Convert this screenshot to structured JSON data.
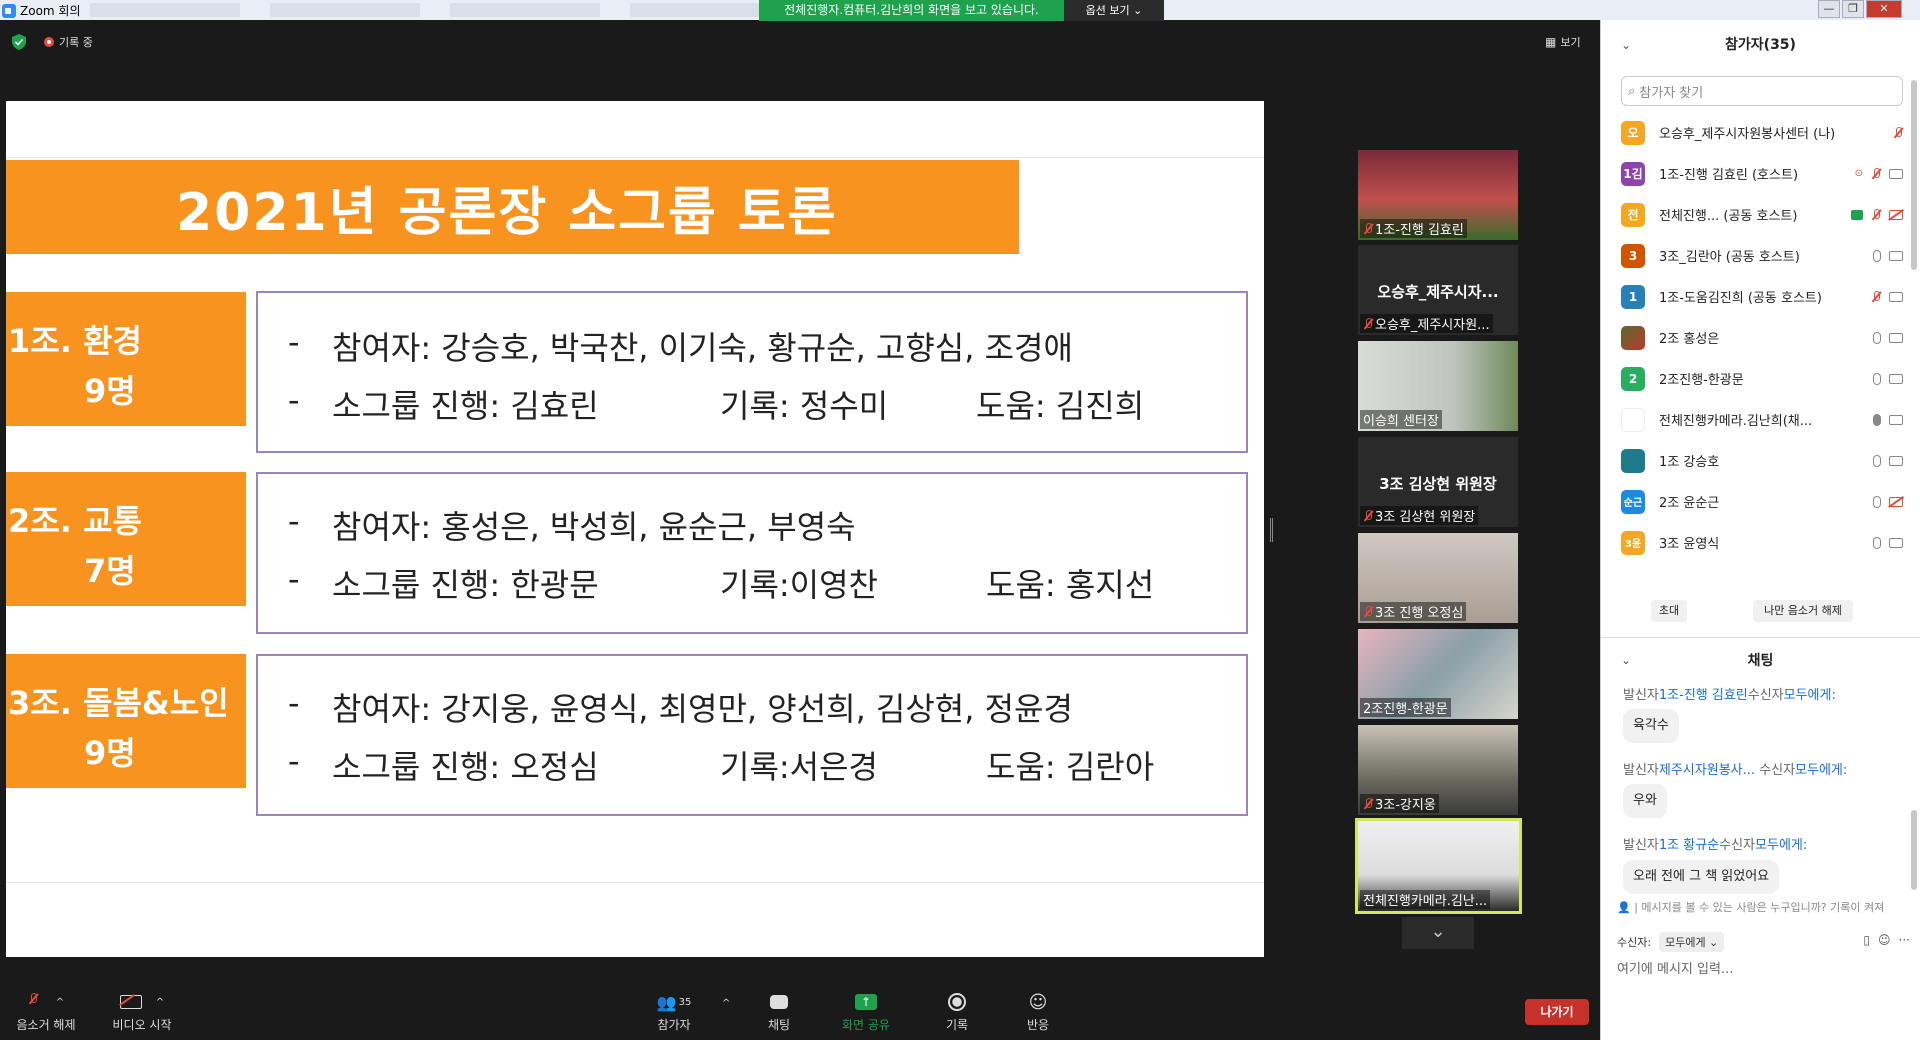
{
  "window": {
    "title": "Zoom 회의"
  },
  "banner": {
    "share_text": "전체진행자.컴퓨터.김난희의 화면을 보고 있습니다.",
    "view_options": "옵션 보기 ⌄"
  },
  "window_controls": [
    "—",
    "❐",
    "✕"
  ],
  "topbar": {
    "recording": "기록 중",
    "view": "보기"
  },
  "slide": {
    "title": "2021년 공론장 소그룹 토론",
    "groups": [
      {
        "label1": "1조. 환경",
        "label2": "9명",
        "participants": "참여자: 강승호, 박국찬, 이기숙, 황규순, 고향심, 조경애",
        "lead": "소그룹 진행: 김효린",
        "record": "기록: 정수미",
        "help": "도움: 김진희"
      },
      {
        "label1": "2조. 교통",
        "label2": "7명",
        "participants": "참여자: 홍성은, 박성희, 윤순근, 부영숙",
        "lead": "소그룹 진행: 한광문",
        "record": "기록:이영찬",
        "help": "도움: 홍지선"
      },
      {
        "label1": "3조. 돌봄&노인",
        "label2": "9명",
        "participants": "참여자: 강지웅, 윤영식, 최영만, 양선희, 김상현, 정윤경",
        "lead": "소그룹 진행: 오정심",
        "record": "기록:서은경",
        "help": "도움: 김란아"
      }
    ]
  },
  "tiles": [
    {
      "name": "1조-진행 김효린",
      "big": "",
      "muted": true
    },
    {
      "name": "오승후_제주시자원...",
      "big": "오승후_제주시자...",
      "muted": true
    },
    {
      "name": "이승희 센터장",
      "big": "",
      "muted": false
    },
    {
      "name": "3조 김상현 위원장",
      "big": "3조 김상현 위원장",
      "muted": true
    },
    {
      "name": "3조 진행 오정심",
      "big": "",
      "muted": true
    },
    {
      "name": "2조진행-한광문",
      "big": "",
      "muted": false
    },
    {
      "name": "3조-강지웅",
      "big": "",
      "muted": true
    },
    {
      "name": "전체진행카메라.김난...",
      "big": "",
      "muted": false
    }
  ],
  "toolbar": {
    "mute": "음소거 해제",
    "video": "비디오 시작",
    "participants": "참가자",
    "participants_count": "35",
    "chat": "채팅",
    "share": "화면 공유",
    "record": "기록",
    "reactions": "반응",
    "leave": "나가기"
  },
  "panel": {
    "title": "참가자(35)",
    "search_placeholder": "참가자 찾기",
    "participants": [
      {
        "avatar": "오",
        "color": "#f5a623",
        "name": "오승후_제주시자원봉사센터 (나)"
      },
      {
        "avatar": "1김",
        "color": "#8e44ad",
        "name": "1조-진행 김효린 (호스트)"
      },
      {
        "avatar": "전",
        "color": "#f5a623",
        "name": "전체진행...     (공동 호스트)"
      },
      {
        "avatar": "3",
        "color": "#d35400",
        "name": "3조_김란아 (공동 호스트)"
      },
      {
        "avatar": "1",
        "color": "#2980b9",
        "name": "1조-도움김진희 (공동 호스트)"
      },
      {
        "avatar": "",
        "color": "#556b2f",
        "name": "2조 홍성은"
      },
      {
        "avatar": "2",
        "color": "#27ae60",
        "name": "2조진행-한광문"
      },
      {
        "avatar": "",
        "color": "#ffffff",
        "name": "전체진행카메라.김난희(채..."
      },
      {
        "avatar": "",
        "color": "#1f7a8c",
        "name": "1조 강승호"
      },
      {
        "avatar": "순근",
        "color": "#1e88e5",
        "name": "2조 윤순근"
      },
      {
        "avatar": "3윤",
        "color": "#f5a623",
        "name": "3조 윤영식"
      }
    ],
    "invite": "초대",
    "unmute_me": "나만 음소거 해제",
    "chat_title": "채팅",
    "messages": [
      {
        "from_prefix": "발신자",
        "from": "1조-진행 김효린",
        "to_prefix": "수신자",
        "to": "모두에게:",
        "text": "육각수"
      },
      {
        "from_prefix": "발신자",
        "from": "제주시자원봉사...",
        "to_prefix": " 수신자",
        "to": "모두에게:",
        "text": "우와"
      },
      {
        "from_prefix": "발신자",
        "from": "1조 황규순",
        "to_prefix": "수신자",
        "to": "모두에게:",
        "text": "오래 전에 그 책 읽었어요"
      }
    ],
    "chat_note": "메시지를 볼 수 있는 사람은 누구입니까? 기록이 켜져",
    "to_label": "수신자:",
    "to_value": "모두에게 ⌄",
    "input_placeholder": "여기에 메시지 입력..."
  }
}
